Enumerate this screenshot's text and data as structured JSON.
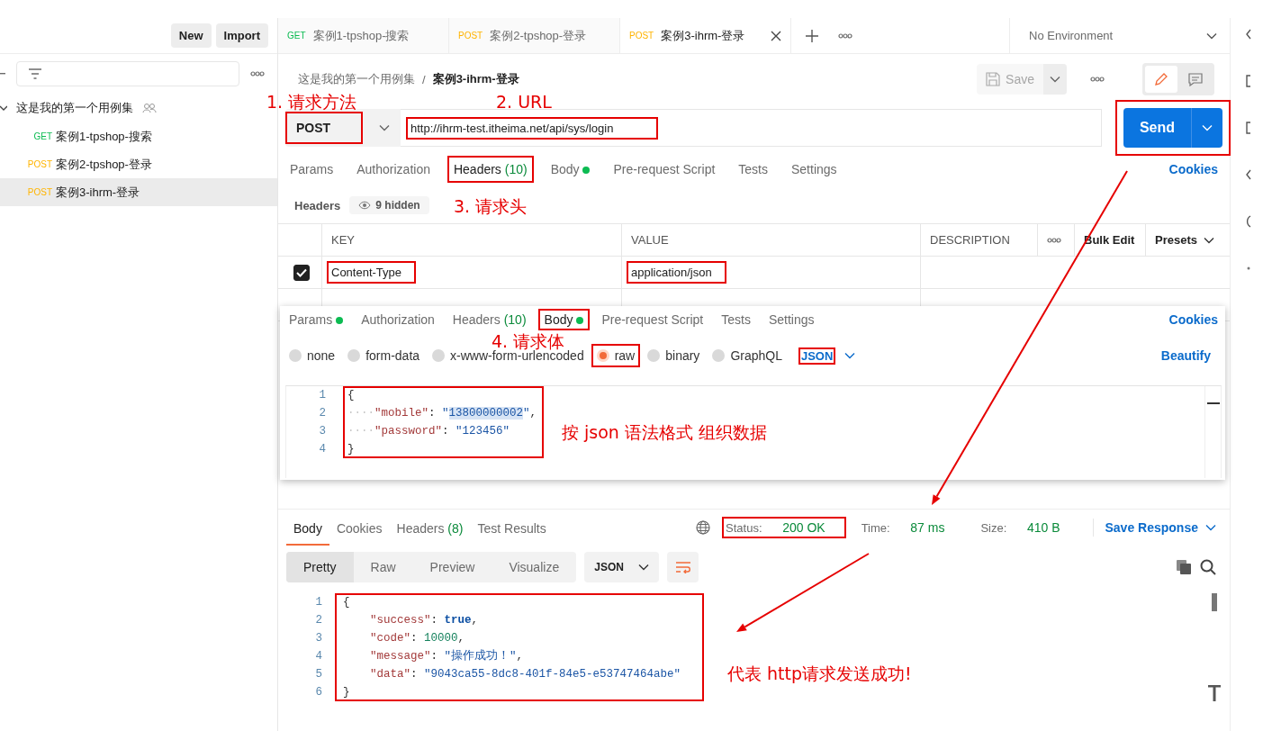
{
  "sidebar": {
    "buttons": [
      "New",
      "Import"
    ],
    "collection": {
      "name": "这是我的第一个用例集",
      "expanded": true,
      "children": [
        {
          "method": "GET",
          "color": "#0cbb52",
          "name": "案例1-tpshop-搜索",
          "selected": false
        },
        {
          "method": "POST",
          "color": "#ffb400",
          "name": "案例2-tpshop-登录",
          "selected": false
        },
        {
          "method": "POST",
          "color": "#ffb400",
          "name": "案例3-ihrm-登录",
          "selected": true
        }
      ]
    }
  },
  "tabs": [
    {
      "method": "GET",
      "color": "#0cbb52",
      "title": "案例1-tpshop-搜索",
      "selected": false
    },
    {
      "method": "POST",
      "color": "#ffb400",
      "title": "案例2-tpshop-登录",
      "selected": false
    },
    {
      "method": "POST",
      "color": "#ffb400",
      "title": "案例3-ihrm-登录",
      "selected": true
    }
  ],
  "environment": "No Environment",
  "breadcrumb": {
    "parent": "这是我的第一个用例集",
    "separator": "/",
    "current": "案例3-ihrm-登录"
  },
  "save_button": "Save",
  "request": {
    "method": "POST",
    "method_annotated": true,
    "url": "http://ihrm-test.itheima.net/api/sys/login",
    "url_annotated": true,
    "send": "Send",
    "send_annotated": true
  },
  "request_tabs": [
    {
      "label": "Params",
      "dot": false,
      "selected": false,
      "annotated": false
    },
    {
      "label": "Authorization",
      "dot": false,
      "selected": false,
      "annotated": false
    },
    {
      "label": "Headers",
      "count": "(10)",
      "dot": false,
      "selected": true,
      "annotated": true
    },
    {
      "label": "Body",
      "dot": true,
      "selected": false,
      "annotated": false
    },
    {
      "label": "Pre-request Script",
      "dot": false,
      "selected": false,
      "annotated": false
    },
    {
      "label": "Tests",
      "dot": false,
      "selected": false,
      "annotated": false
    },
    {
      "label": "Settings",
      "dot": false,
      "selected": false,
      "annotated": false
    }
  ],
  "request_cookies": "Cookies",
  "headers_summary": {
    "label": "Headers",
    "hidden": "9 hidden"
  },
  "headers_table": {
    "columns": [
      "KEY",
      "VALUE",
      "DESCRIPTION"
    ],
    "bulk_edit": "Bulk Edit",
    "presets": "Presets",
    "rows": [
      {
        "checked": true,
        "key": "Content-Type",
        "value": "application/json",
        "annotated": true
      }
    ]
  },
  "body_panel": {
    "tabs": [
      {
        "label": "Params",
        "dot": true,
        "selected": false,
        "annotated": false
      },
      {
        "label": "Authorization",
        "dot": false,
        "selected": false,
        "annotated": false
      },
      {
        "label": "Headers",
        "count": "(10)",
        "dot": false,
        "selected": false,
        "annotated": false
      },
      {
        "label": "Body",
        "dot": true,
        "selected": true,
        "annotated": true
      },
      {
        "label": "Pre-request Script",
        "dot": false,
        "selected": false,
        "annotated": false
      },
      {
        "label": "Tests",
        "dot": false,
        "selected": false,
        "annotated": false
      },
      {
        "label": "Settings",
        "dot": false,
        "selected": false,
        "annotated": false
      }
    ],
    "cookies": "Cookies",
    "modes": [
      {
        "label": "none",
        "selected": false,
        "annotated": false
      },
      {
        "label": "form-data",
        "selected": false,
        "annotated": false
      },
      {
        "label": "x-www-form-urlencoded",
        "selected": false,
        "annotated": false
      },
      {
        "label": "raw",
        "selected": true,
        "annotated": true
      },
      {
        "label": "binary",
        "selected": false,
        "annotated": false
      },
      {
        "label": "GraphQL",
        "selected": false,
        "annotated": false
      }
    ],
    "format": "JSON",
    "format_annotated": true,
    "beautify": "Beautify",
    "code_annotated": true,
    "code": [
      {
        "number": "1",
        "tokens": [
          {
            "kind": "punct",
            "text": "{"
          }
        ]
      },
      {
        "number": "2",
        "tokens": [
          {
            "kind": "indent",
            "text": "····"
          },
          {
            "kind": "key",
            "text": "\"mobile\""
          },
          {
            "kind": "punct",
            "text": ": "
          },
          {
            "kind": "string",
            "text": "\""
          },
          {
            "kind": "string",
            "text": "13800000002",
            "highlighted": true
          },
          {
            "kind": "string",
            "text": "\""
          },
          {
            "kind": "punct",
            "text": ","
          }
        ]
      },
      {
        "number": "3",
        "tokens": [
          {
            "kind": "indent",
            "text": "····"
          },
          {
            "kind": "key",
            "text": "\"password\""
          },
          {
            "kind": "punct",
            "text": ": "
          },
          {
            "kind": "string",
            "text": "\"123456\""
          }
        ]
      },
      {
        "number": "4",
        "tokens": [
          {
            "kind": "punct",
            "text": "}"
          }
        ]
      }
    ]
  },
  "response": {
    "tabs": [
      {
        "label": "Body",
        "selected": true
      },
      {
        "label": "Cookies",
        "selected": false
      },
      {
        "label": "Headers",
        "count": "(8)",
        "selected": false
      },
      {
        "label": "Test Results",
        "selected": false
      }
    ],
    "metrics": [
      {
        "label": "Status:",
        "value": "200 OK",
        "annotated": true
      },
      {
        "label": "Time:",
        "value": "87 ms",
        "annotated": false
      },
      {
        "label": "Size:",
        "value": "410 B",
        "annotated": false
      }
    ],
    "save": "Save Response",
    "views": [
      {
        "label": "Pretty",
        "selected": true
      },
      {
        "label": "Raw",
        "selected": false
      },
      {
        "label": "Preview",
        "selected": false
      },
      {
        "label": "Visualize",
        "selected": false
      }
    ],
    "format": "JSON",
    "code_annotated": true,
    "code": [
      {
        "number": "1",
        "tokens": [
          {
            "kind": "punct",
            "text": "{"
          }
        ]
      },
      {
        "number": "2",
        "tokens": [
          {
            "kind": "key",
            "text": "    \"success\""
          },
          {
            "kind": "punct",
            "text": ": "
          },
          {
            "kind": "bool",
            "text": "true"
          },
          {
            "kind": "punct",
            "text": ","
          }
        ]
      },
      {
        "number": "3",
        "tokens": [
          {
            "kind": "key",
            "text": "    \"code\""
          },
          {
            "kind": "punct",
            "text": ": "
          },
          {
            "kind": "number",
            "text": "10000"
          },
          {
            "kind": "punct",
            "text": ","
          }
        ]
      },
      {
        "number": "4",
        "tokens": [
          {
            "kind": "key",
            "text": "    \"message\""
          },
          {
            "kind": "punct",
            "text": ": "
          },
          {
            "kind": "string",
            "text": "\"操作成功！\""
          },
          {
            "kind": "punct",
            "text": ","
          }
        ]
      },
      {
        "number": "5",
        "tokens": [
          {
            "kind": "key",
            "text": "    \"data\""
          },
          {
            "kind": "punct",
            "text": ": "
          },
          {
            "kind": "string",
            "text": "\"9043ca55-8dc8-401f-84e5-e53747464abe\""
          }
        ]
      },
      {
        "number": "6",
        "tokens": [
          {
            "kind": "punct",
            "text": "}"
          }
        ]
      }
    ]
  },
  "annotations": [
    "1. 请求方法",
    "2. URL",
    "3. 请求头",
    "4. 请求体",
    "按 json 语法格式 组织数据",
    "代表 http请求发送成功!"
  ]
}
